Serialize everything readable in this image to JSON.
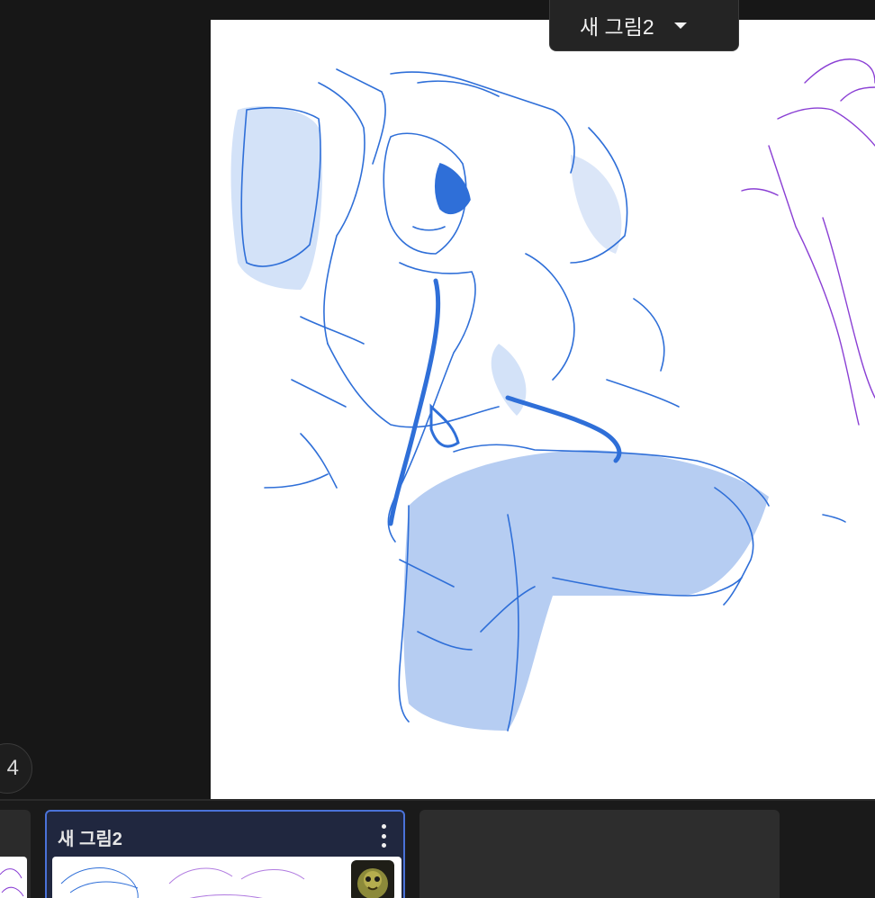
{
  "document": {
    "title": "새 그림2"
  },
  "page_indicator": {
    "text": "4"
  },
  "pages": [
    {
      "title": "새 그림2",
      "active": true
    }
  ],
  "colors": {
    "background": "#171717",
    "canvas": "#ffffff",
    "sketch_blue": "#2f6fd8",
    "sketch_light_blue": "#a9c4f0",
    "sketch_purple": "#8a3fd4",
    "active_card_border": "#4a72d8",
    "active_card_bg": "#20273f"
  },
  "icons": {
    "dropdown": "chevron-down-icon",
    "more": "more-vertical-icon"
  }
}
